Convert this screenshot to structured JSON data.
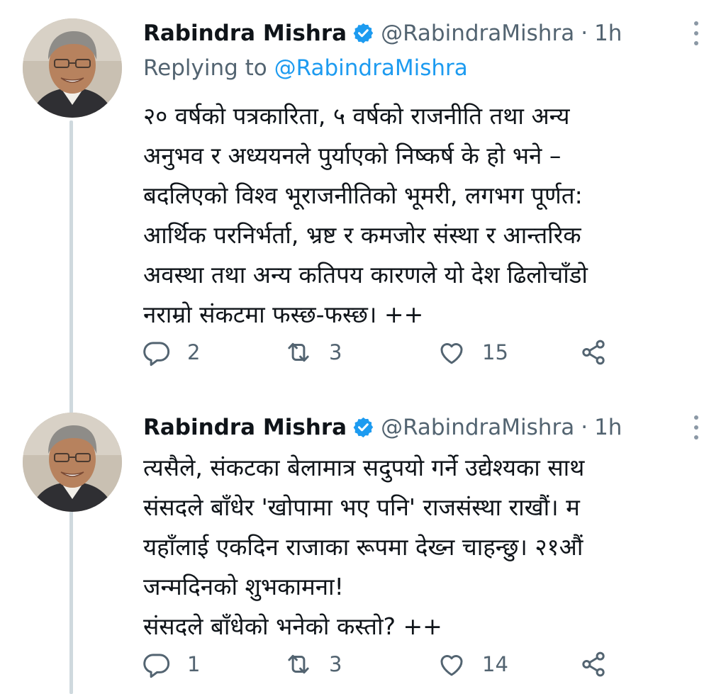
{
  "colors": {
    "text": "#0f1419",
    "secondary": "#536471",
    "accent": "#1d9bf0",
    "thread_line": "#cfd9de"
  },
  "tweets": [
    {
      "author": "Rabindra Mishra",
      "handle": "@RabindraMishra",
      "separator": "·",
      "time": "1h",
      "replying_label": "Replying to",
      "replying_to": "@RabindraMishra",
      "lines": [
        "२० वर्षको पत्रकारिता, ५ वर्षको राजनीति तथा अन्य",
        "अनुभव र अध्ययनले पुर्याएको निष्कर्ष के हो भने –",
        "बदलिएको विश्व भूराजनीतिको भूमरी, लगभग पूर्णत:",
        "आर्थिक परनिर्भर्ता, भ्रष्ट र कमजोर संस्था र आन्तरिक",
        "अवस्था तथा अन्य कतिपय कारणले यो देश ढिलोचाँडो",
        "नराम्रो संकटमा फस्छ-फस्छ। ++"
      ],
      "replies": "2",
      "retweets": "3",
      "likes": "15"
    },
    {
      "author": "Rabindra Mishra",
      "handle": "@RabindraMishra",
      "separator": "·",
      "time": "1h",
      "lines": [
        "त्यसैले, संकटका बेलामात्र सदुपयो गर्ने उद्येश्यका साथ",
        "संसदले बाँधेर 'खोपामा भए पनि' राजसंस्था राखौं। म",
        "यहाँलाई एकदिन राजाका रूपमा देख्न चाहन्छु। २१औं",
        "जन्मदिनको शुभकामना!",
        "संसदले बाँधेको भनेको कस्तो? ++"
      ],
      "replies": "1",
      "retweets": "3",
      "likes": "14"
    }
  ]
}
